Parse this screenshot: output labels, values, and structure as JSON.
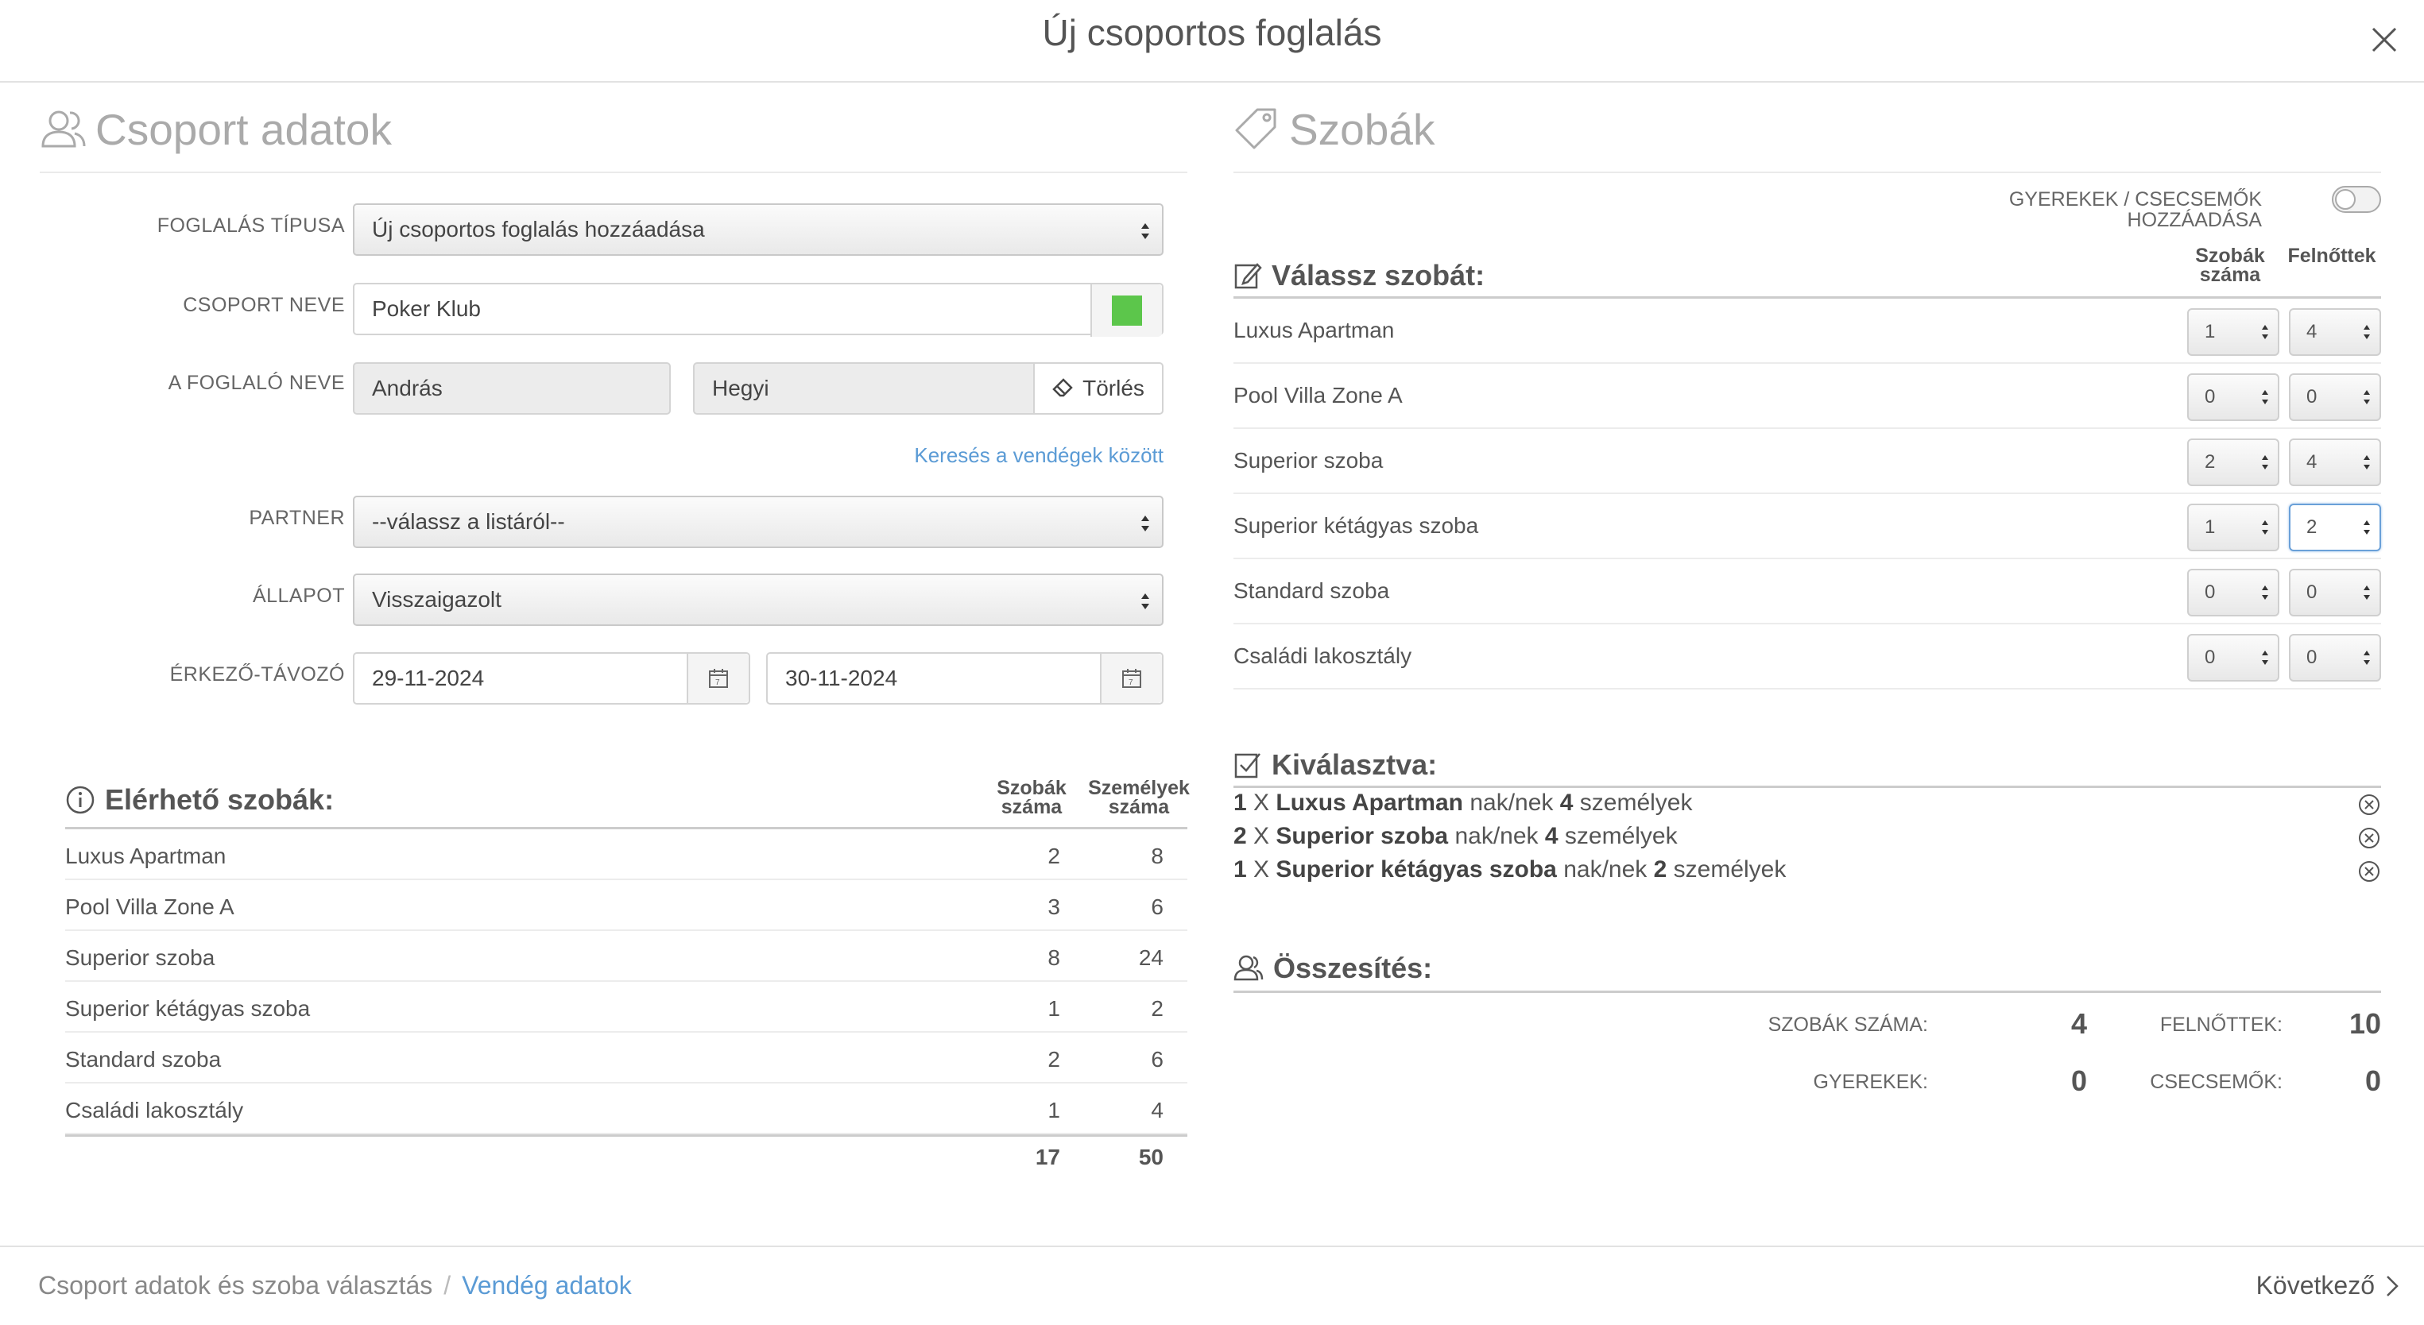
{
  "header": {
    "title": "Új csoportos foglalás"
  },
  "left": {
    "section_title": "Csoport adatok",
    "booking_type": {
      "label": "FOGLALÁS TÍPUSA",
      "value": "Új csoportos foglalás hozzáadása"
    },
    "group_name": {
      "label": "CSOPORT NEVE",
      "value": "Poker Klub",
      "color": "#5cc64b"
    },
    "booker": {
      "label": "A FOGLALÓ NEVE",
      "first": "András",
      "last": "Hegyi",
      "clear_label": "Törlés"
    },
    "search_link": "Keresés a vendégek között",
    "partner": {
      "label": "PARTNER",
      "value": "--válassz a listáról--"
    },
    "status": {
      "label": "ÁLLAPOT",
      "value": "Visszaigazolt"
    },
    "dates": {
      "label": "ÉRKEZŐ-TÁVOZÓ",
      "arrival": "29-11-2024",
      "departure": "30-11-2024"
    },
    "available": {
      "title": "Elérhető szobák:",
      "col_rooms_1": "Szobák",
      "col_rooms_2": "száma",
      "col_persons_1": "Személyek",
      "col_persons_2": "száma",
      "rows": [
        {
          "name": "Luxus Apartman",
          "rooms": "2",
          "persons": "8"
        },
        {
          "name": "Pool Villa Zone A",
          "rooms": "3",
          "persons": "6"
        },
        {
          "name": "Superior szoba",
          "rooms": "8",
          "persons": "24"
        },
        {
          "name": "Superior kétágyas szoba",
          "rooms": "1",
          "persons": "2"
        },
        {
          "name": "Standard szoba",
          "rooms": "2",
          "persons": "6"
        },
        {
          "name": "Családi lakosztály",
          "rooms": "1",
          "persons": "4"
        }
      ],
      "total_rooms": "17",
      "total_persons": "50"
    }
  },
  "right": {
    "section_title": "Szobák",
    "children_toggle_label_1": "GYEREKEK / CSECSEMŐK",
    "children_toggle_label_2": "HOZZÁADÁSA",
    "children_toggle_on": false,
    "choose": {
      "title": "Válassz szobát:",
      "col_rooms_1": "Szobák",
      "col_rooms_2": "száma",
      "col_adults": "Felnőttek",
      "rows": [
        {
          "name": "Luxus Apartman",
          "rooms": "1",
          "adults": "4"
        },
        {
          "name": "Pool Villa Zone A",
          "rooms": "0",
          "adults": "0"
        },
        {
          "name": "Superior szoba",
          "rooms": "2",
          "adults": "4"
        },
        {
          "name": "Superior kétágyas szoba",
          "rooms": "1",
          "adults": "2"
        },
        {
          "name": "Standard szoba",
          "rooms": "0",
          "adults": "0"
        },
        {
          "name": "Családi lakosztály",
          "rooms": "0",
          "adults": "0"
        }
      ]
    },
    "selected": {
      "title": "Kiválasztva:",
      "items": [
        {
          "count": "1",
          "x": "X",
          "room": "Luxus Apartman",
          "mid": "nak/nek",
          "persons": "4",
          "suffix": "személyek"
        },
        {
          "count": "2",
          "x": "X",
          "room": "Superior szoba",
          "mid": "nak/nek",
          "persons": "4",
          "suffix": "személyek"
        },
        {
          "count": "1",
          "x": "X",
          "room": "Superior kétágyas szoba",
          "mid": "nak/nek",
          "persons": "2",
          "suffix": "személyek"
        }
      ]
    },
    "summary": {
      "title": "Összesítés:",
      "rooms_label": "SZOBÁK SZÁMA:",
      "rooms_value": "4",
      "adults_label": "FELNŐTTEK:",
      "adults_value": "10",
      "children_label": "GYEREKEK:",
      "children_value": "0",
      "infants_label": "CSECSEMŐK:",
      "infants_value": "0"
    }
  },
  "footer": {
    "step1": "Csoport adatok és szoba választás",
    "separator": "/",
    "step2": "Vendég adatok",
    "next": "Következő"
  }
}
